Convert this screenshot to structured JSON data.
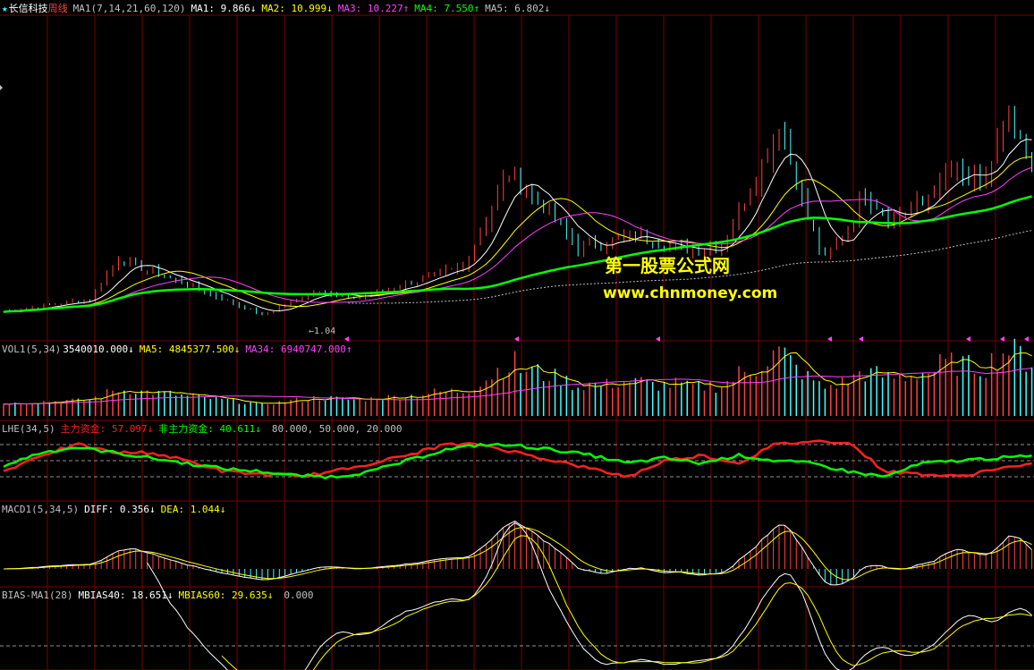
{
  "colors": {
    "bg": "#000000",
    "grid": "#7a0000",
    "up": "#ff4040",
    "down": "#40ffff",
    "white": "#ffffff",
    "yellow": "#ffff00",
    "magenta": "#ff40ff",
    "green": "#00ff00",
    "red": "#ff2020",
    "gray": "#c0c0c0"
  },
  "main": {
    "title_icon": "star-icon",
    "stock_name": "长信科技",
    "period": "周线",
    "ma_param": "MA1(7,14,21,60,120)",
    "items": [
      {
        "label": "MA1:",
        "value": "9.866",
        "arrow": "↓",
        "color": "#ffffff"
      },
      {
        "label": "MA2:",
        "value": "10.999",
        "arrow": "↓",
        "color": "#ffff00"
      },
      {
        "label": "MA3:",
        "value": "10.227",
        "arrow": "↑",
        "color": "#ff40ff"
      },
      {
        "label": "MA4:",
        "value": "7.550",
        "arrow": "↑",
        "color": "#00ff00"
      },
      {
        "label": "MA5:",
        "value": "6.802",
        "arrow": "↓",
        "color": "#c0c0c0"
      }
    ],
    "low_marker": "1.04"
  },
  "vol": {
    "title": "VOL1(5,34)",
    "items": [
      {
        "label": "",
        "value": "3540010.000",
        "arrow": "↓",
        "color": "#ffffff"
      },
      {
        "label": "MA5:",
        "value": "4845377.500",
        "arrow": "↓",
        "color": "#ffff00"
      },
      {
        "label": "MA34:",
        "value": "6940747.000",
        "arrow": "↑",
        "color": "#ff40ff"
      }
    ]
  },
  "lhe": {
    "title": "LHE(34,5)",
    "items": [
      {
        "label": "主力资金:",
        "value": "57.097",
        "arrow": "↓",
        "color": "#ff2020"
      },
      {
        "label": "非主力资金:",
        "value": "40.611",
        "arrow": "↓",
        "color": "#00ff00"
      }
    ],
    "levels": "80.000, 50.000, 20.000"
  },
  "macd": {
    "title": "MACD1(5,34,5)",
    "items": [
      {
        "label": "DIFF:",
        "value": "0.356",
        "arrow": "↓",
        "color": "#ffffff"
      },
      {
        "label": "DEA:",
        "value": "1.044",
        "arrow": "↓",
        "color": "#ffff00"
      }
    ]
  },
  "bias": {
    "title": "BIAS-MA1(28)",
    "items": [
      {
        "label": "MBIAS40:",
        "value": "18.651",
        "arrow": "↓",
        "color": "#ffffff"
      },
      {
        "label": "MBIAS60:",
        "value": "29.635",
        "arrow": "↓",
        "color": "#ffff00"
      }
    ],
    "zero": "0.000"
  },
  "watermark": {
    "line1": "第一股票公式网",
    "line2": "www.chnmoney.com"
  },
  "chart_data": {
    "type": "line",
    "series_points": 180,
    "price": {
      "x": [
        0,
        15,
        20,
        25,
        35,
        45,
        55,
        60,
        65,
        80,
        88,
        95,
        100,
        110,
        120,
        125,
        130,
        135,
        140,
        143,
        146,
        150,
        155,
        160,
        165,
        170,
        175,
        179
      ],
      "y": [
        1.2,
        2.0,
        4.5,
        3.8,
        2.5,
        1.0,
        2.6,
        2.0,
        2.4,
        4.0,
        10.0,
        7.5,
        5.2,
        6.0,
        5.0,
        5.4,
        9.0,
        13.0,
        7.0,
        4.5,
        6.0,
        8.5,
        7.0,
        8.0,
        10.0,
        9.0,
        13.0,
        10.0
      ]
    },
    "lhe": {
      "main": [
        40,
        65,
        75,
        65,
        55,
        45,
        35,
        30,
        22,
        20,
        30,
        50,
        70,
        80,
        78,
        70,
        60,
        45,
        55,
        45,
        60,
        50,
        45,
        30,
        20,
        45,
        50,
        55,
        58
      ],
      "other": [
        30,
        60,
        80,
        65,
        65,
        50,
        30,
        25,
        20,
        30,
        45,
        60,
        80,
        80,
        65,
        50,
        35,
        20,
        50,
        60,
        45,
        80,
        86,
        85,
        30,
        25,
        20,
        35,
        42
      ]
    },
    "levels": [
      80,
      50,
      20
    ]
  }
}
